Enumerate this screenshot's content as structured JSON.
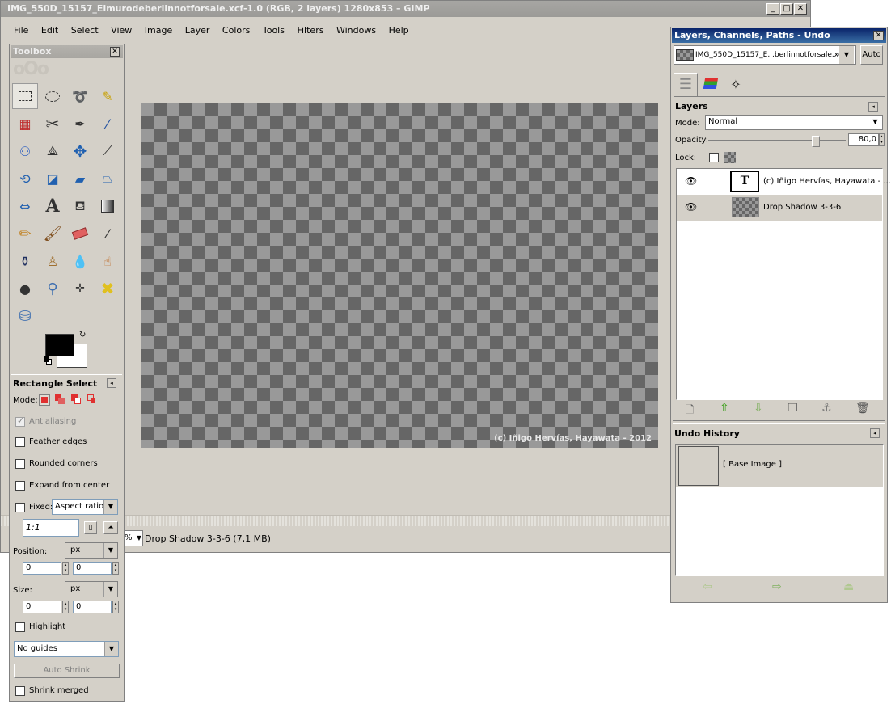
{
  "main_window": {
    "title": "IMG_550D_15157_Elmurodeberlinnotforsale.xcf-1.0 (RGB, 2 layers) 1280x853 – GIMP",
    "menu": [
      "File",
      "Edit",
      "Select",
      "View",
      "Image",
      "Layer",
      "Colors",
      "Tools",
      "Filters",
      "Windows",
      "Help"
    ],
    "watermark": "(c) Iñigo Hervías, Hayawata - 2012",
    "status_zoom_suffix": "%",
    "status_text": "Drop Shadow 3-3-6 (7,1 MB)"
  },
  "toolbox": {
    "title": "Toolbox",
    "tool_icons": [
      "rect-select-icon",
      "ellipse-select-icon",
      "free-select-icon",
      "fuzzy-select-icon",
      "color-select-icon",
      "scissors-icon",
      "paths-icon",
      "color-picker-icon",
      "zoom-tool-icon",
      "measure-icon",
      "move-icon",
      "align-icon",
      "crop-icon",
      "rotate-icon",
      "scale-icon",
      "shear-icon",
      "flip-icon",
      "text-tool-icon",
      "bucket-fill-icon",
      "blend-icon",
      "pencil-icon",
      "paintbrush-icon",
      "eraser-icon",
      "airbrush-icon",
      "ink-icon",
      "clone-icon",
      "blur-icon",
      "smudge-icon",
      "dodge-burn-icon",
      "magnify-icon",
      "perspective-clone-icon",
      "heal-icon",
      "cage-icon"
    ],
    "tool_options": {
      "title": "Rectangle Select",
      "mode_label": "Mode:",
      "antialiasing": "Antialiasing",
      "feather_edges": "Feather edges",
      "rounded_corners": "Rounded corners",
      "expand_from_center": "Expand from center",
      "fixed_label": "Fixed:",
      "fixed_value": "Aspect ratio",
      "ratio_value": "1:1",
      "position_label": "Position:",
      "position_unit": "px",
      "position_x": "0",
      "position_y": "0",
      "size_label": "Size:",
      "size_unit": "px",
      "size_w": "0",
      "size_h": "0",
      "highlight": "Highlight",
      "guides_value": "No guides",
      "auto_shrink": "Auto Shrink",
      "shrink_merged": "Shrink merged"
    }
  },
  "dock": {
    "title": "Layers, Channels, Paths - Undo",
    "image_selector": "IMG_550D_15157_E...berlinnotforsale.xcf-1",
    "auto_button": "Auto",
    "layers": {
      "title": "Layers",
      "mode_label": "Mode:",
      "mode_value": "Normal",
      "opacity_label": "Opacity:",
      "opacity_value": "80,0",
      "opacity_fraction": 0.8,
      "lock_label": "Lock:",
      "items": [
        {
          "name": "(c) Iñigo Hervías, Hayawata - ...",
          "type": "text"
        },
        {
          "name": "Drop Shadow 3-3-6",
          "type": "image"
        }
      ]
    },
    "undo": {
      "title": "Undo History",
      "items": [
        "[ Base Image ]"
      ]
    }
  }
}
